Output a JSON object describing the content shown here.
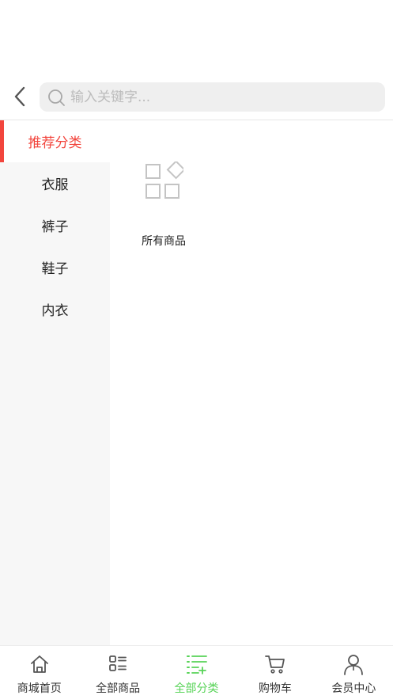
{
  "header": {
    "search_placeholder": "输入关键字...",
    "search_value": ""
  },
  "sidebar": {
    "items": [
      {
        "label": "推荐分类",
        "active": true
      },
      {
        "label": "衣服",
        "active": false
      },
      {
        "label": "裤子",
        "active": false
      },
      {
        "label": "鞋子",
        "active": false
      },
      {
        "label": "内衣",
        "active": false
      }
    ]
  },
  "content": {
    "items": [
      {
        "label": "所有商品",
        "icon": "category-grid-icon"
      }
    ]
  },
  "tabbar": {
    "items": [
      {
        "label": "商城首页",
        "icon": "home-icon",
        "active": false
      },
      {
        "label": "全部商品",
        "icon": "list-icon",
        "active": false
      },
      {
        "label": "全部分类",
        "icon": "category-list-icon",
        "active": true
      },
      {
        "label": "购物车",
        "icon": "cart-icon",
        "active": false
      },
      {
        "label": "会员中心",
        "icon": "user-icon",
        "active": false
      }
    ]
  },
  "colors": {
    "accent_red": "#f2453d",
    "active_green": "#57d357",
    "icon_gray": "#555555"
  }
}
